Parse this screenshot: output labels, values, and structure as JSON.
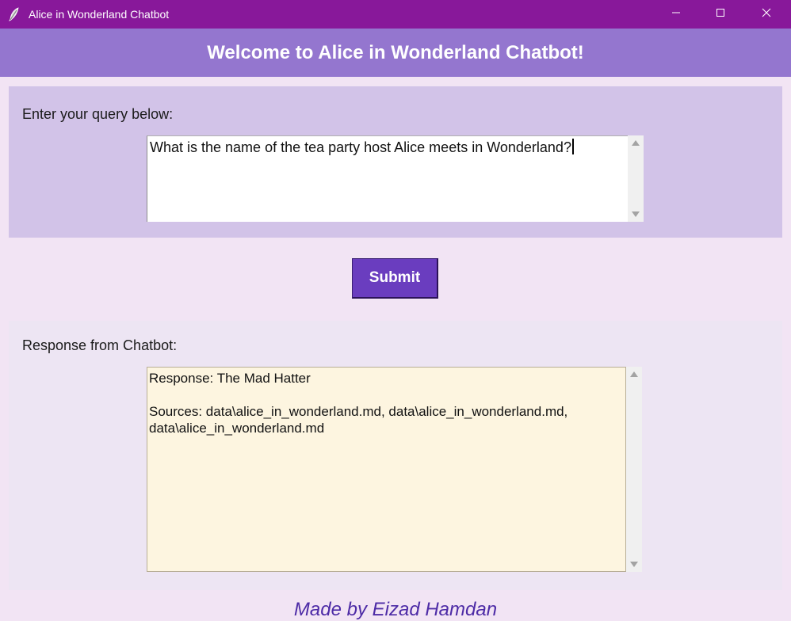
{
  "window": {
    "title": "Alice in Wonderland Chatbot",
    "icon": "feather-icon",
    "controls": [
      "minimize-icon",
      "maximize-icon",
      "close-icon"
    ]
  },
  "header": {
    "title": "Welcome to Alice in Wonderland Chatbot!"
  },
  "query": {
    "label": "Enter your query below:",
    "value": "What is the name of the tea party host Alice meets in Wonderland?"
  },
  "submit": {
    "label": "Submit"
  },
  "response": {
    "label": "Response from Chatbot:",
    "line1": "Response: The Mad Hatter",
    "line2": "Sources: data\\alice_in_wonderland.md, data\\alice_in_wonderland.md,",
    "line3": "data\\alice_in_wonderland.md"
  },
  "footer": {
    "credit": "Made by Eizad Hamdan"
  },
  "colors": {
    "titlebar": "#88189a",
    "header": "#9476cf",
    "background": "#f2e4f4",
    "query_panel": "#d2c3e8",
    "submit": "#6a3dbf",
    "response_box": "#fdf5e0",
    "footer_text": "#4d2ba6"
  }
}
